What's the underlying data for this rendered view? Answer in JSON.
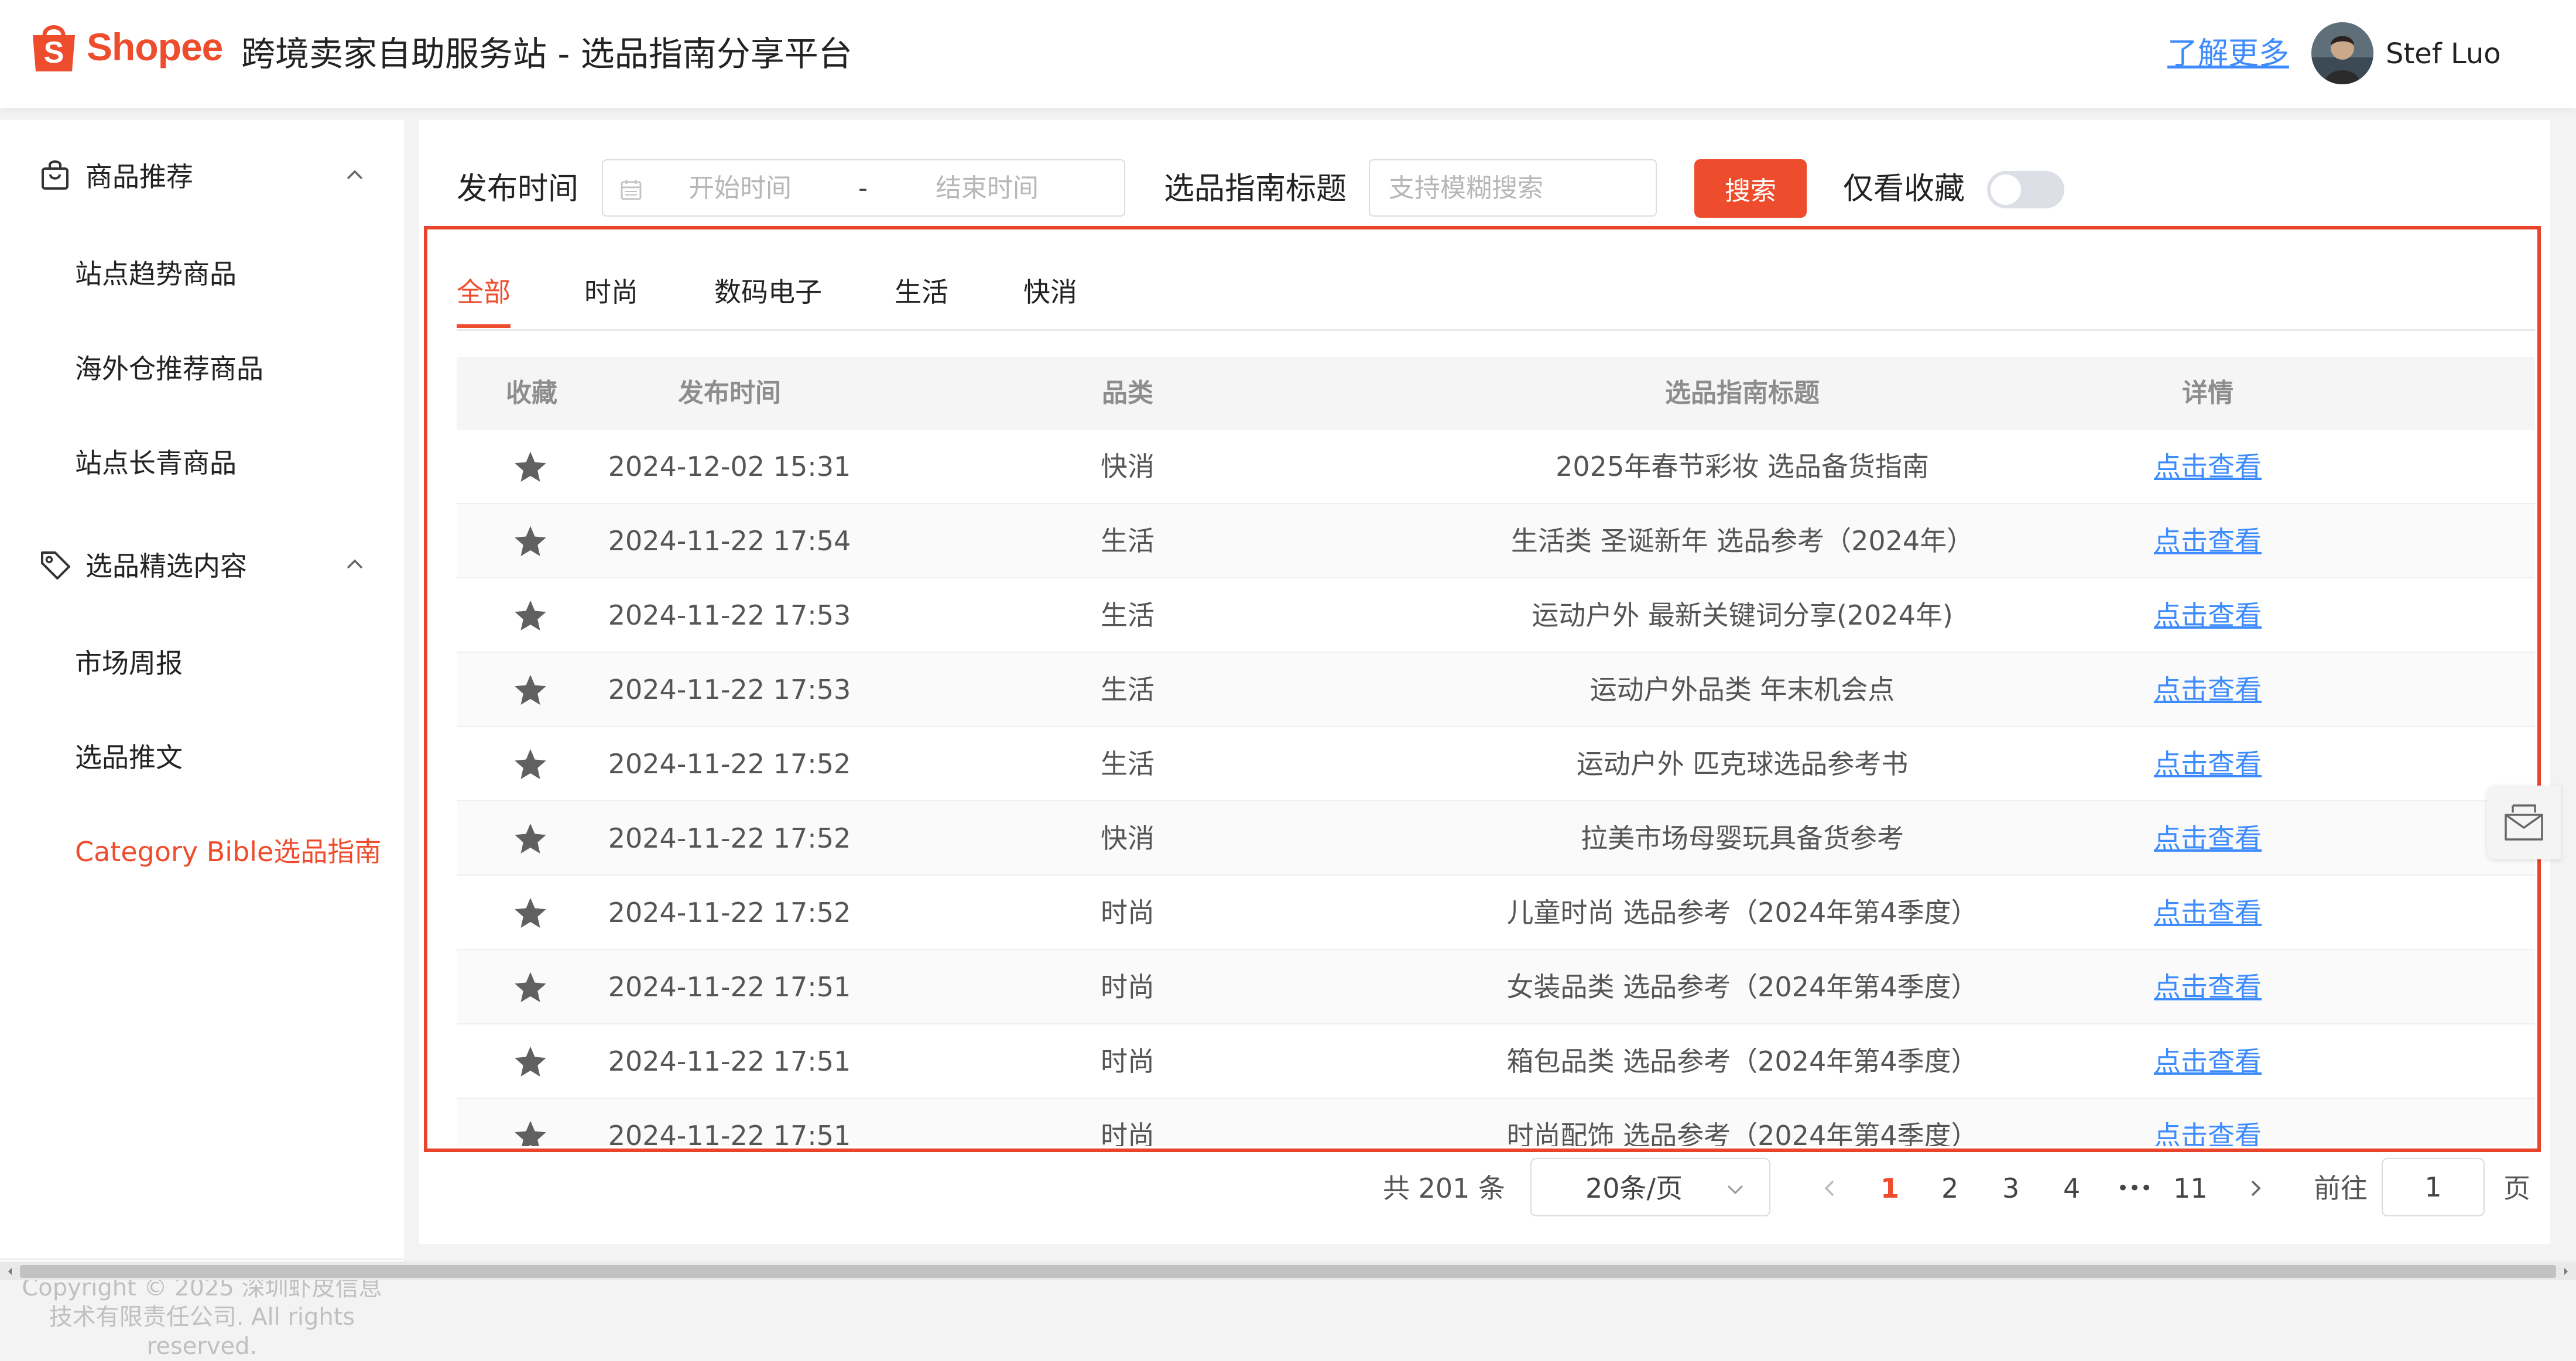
{
  "header": {
    "logo_text": "Shopee",
    "title": "跨境卖家自助服务站 - 选品指南分享平台",
    "learn_more": "了解更多",
    "username": "Stef Luo"
  },
  "sidebar": {
    "groups": [
      {
        "label": "商品推荐",
        "items": [
          "站点趋势商品",
          "海外仓推荐商品",
          "站点长青商品"
        ]
      },
      {
        "label": "选品精选内容",
        "items": [
          "市场周报",
          "选品推文",
          "Category Bible选品指南"
        ]
      }
    ],
    "active_item": "Category Bible选品指南",
    "copyright": "Copyright © 2025 深圳虾皮信息技术有限责任公司. All rights reserved."
  },
  "filters": {
    "publish_time_label": "发布时间",
    "start_placeholder": "开始时间",
    "range_separator": "-",
    "end_placeholder": "结束时间",
    "title_label": "选品指南标题",
    "title_placeholder": "支持模糊搜索",
    "search_button": "搜索",
    "favorites_only_label": "仅看收藏",
    "favorites_only_on": false
  },
  "tabs": [
    "全部",
    "时尚",
    "数码电子",
    "生活",
    "快消"
  ],
  "active_tab": "全部",
  "table": {
    "columns": [
      "收藏",
      "发布时间",
      "品类",
      "选品指南标题",
      "详情"
    ],
    "rows": [
      {
        "time": "2024-12-02 15:31",
        "category": "快消",
        "title": "2025年春节彩妆 选品备货指南",
        "detail": "点击查看"
      },
      {
        "time": "2024-11-22 17:54",
        "category": "生活",
        "title": "生活类 圣诞新年 选品参考（2024年）",
        "detail": "点击查看"
      },
      {
        "time": "2024-11-22 17:53",
        "category": "生活",
        "title": "运动户外 最新关键词分享(2024年)",
        "detail": "点击查看"
      },
      {
        "time": "2024-11-22 17:53",
        "category": "生活",
        "title": "运动户外品类 年末机会点",
        "detail": "点击查看"
      },
      {
        "time": "2024-11-22 17:52",
        "category": "生活",
        "title": "运动户外 匹克球选品参考书",
        "detail": "点击查看"
      },
      {
        "time": "2024-11-22 17:52",
        "category": "快消",
        "title": "拉美市场母婴玩具备货参考",
        "detail": "点击查看"
      },
      {
        "time": "2024-11-22 17:52",
        "category": "时尚",
        "title": "儿童时尚 选品参考（2024年第4季度）",
        "detail": "点击查看"
      },
      {
        "time": "2024-11-22 17:51",
        "category": "时尚",
        "title": "女装品类 选品参考（2024年第4季度）",
        "detail": "点击查看"
      },
      {
        "time": "2024-11-22 17:51",
        "category": "时尚",
        "title": "箱包品类 选品参考（2024年第4季度）",
        "detail": "点击查看"
      },
      {
        "time": "2024-11-22 17:51",
        "category": "时尚",
        "title": "时尚配饰 选品参考（2024年第4季度）",
        "detail": "点击查看"
      }
    ]
  },
  "pagination": {
    "total": "共 201 条",
    "page_size": "20条/页",
    "pages": [
      "1",
      "2",
      "3",
      "4",
      "•••",
      "11"
    ],
    "current_page": "1",
    "goto_label": "前往",
    "goto_value": "1",
    "page_suffix": "页"
  },
  "colors": {
    "brand": "#ee4d2d",
    "link": "#3d8bfd",
    "highlight_frame": "#e8442b"
  },
  "icons": [
    "shopee-bag-icon",
    "shopping-bag-icon",
    "tag-icon",
    "chevron-up-icon",
    "calendar-icon",
    "star-icon",
    "chevron-left-icon",
    "chevron-right-icon",
    "chevron-down-icon",
    "message-icon"
  ]
}
